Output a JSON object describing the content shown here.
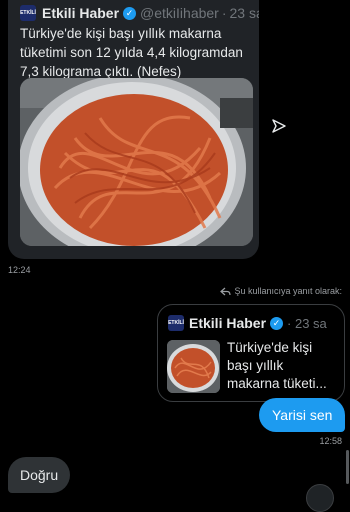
{
  "shared_tweet": {
    "author": "Etkili Haber",
    "handle": "@etkiIihaber",
    "time": "23 sa",
    "text": "Türkiye'de kişi başı yıllık makarna tüketimi son 12 yılda 4,4 kilogramdan 7,3 kilograma çıktı. (Nefes)",
    "image_icon": "pasta-pot-photo",
    "avatar_text": "ETKİLİ"
  },
  "message_time_1": "12:24",
  "reply_note": "Şu kullanıcıya yanıt olarak:",
  "quoted_tweet": {
    "author": "Etkili Haber",
    "time": "23 sa",
    "text": "Türkiye'de kişi başı yıllık makarna tüketi...",
    "avatar_text": "ETKİLİ"
  },
  "sent_message": "Yarisi sen",
  "message_time_2": "12:58",
  "received_message": "Doğru",
  "colors": {
    "accent": "#1d9bf0",
    "card_bg": "#202327",
    "received_bubble": "#2f3336"
  },
  "icons": [
    "verified-badge-icon",
    "share-icon",
    "reply-arrow-icon",
    "scroll-down-icon"
  ]
}
